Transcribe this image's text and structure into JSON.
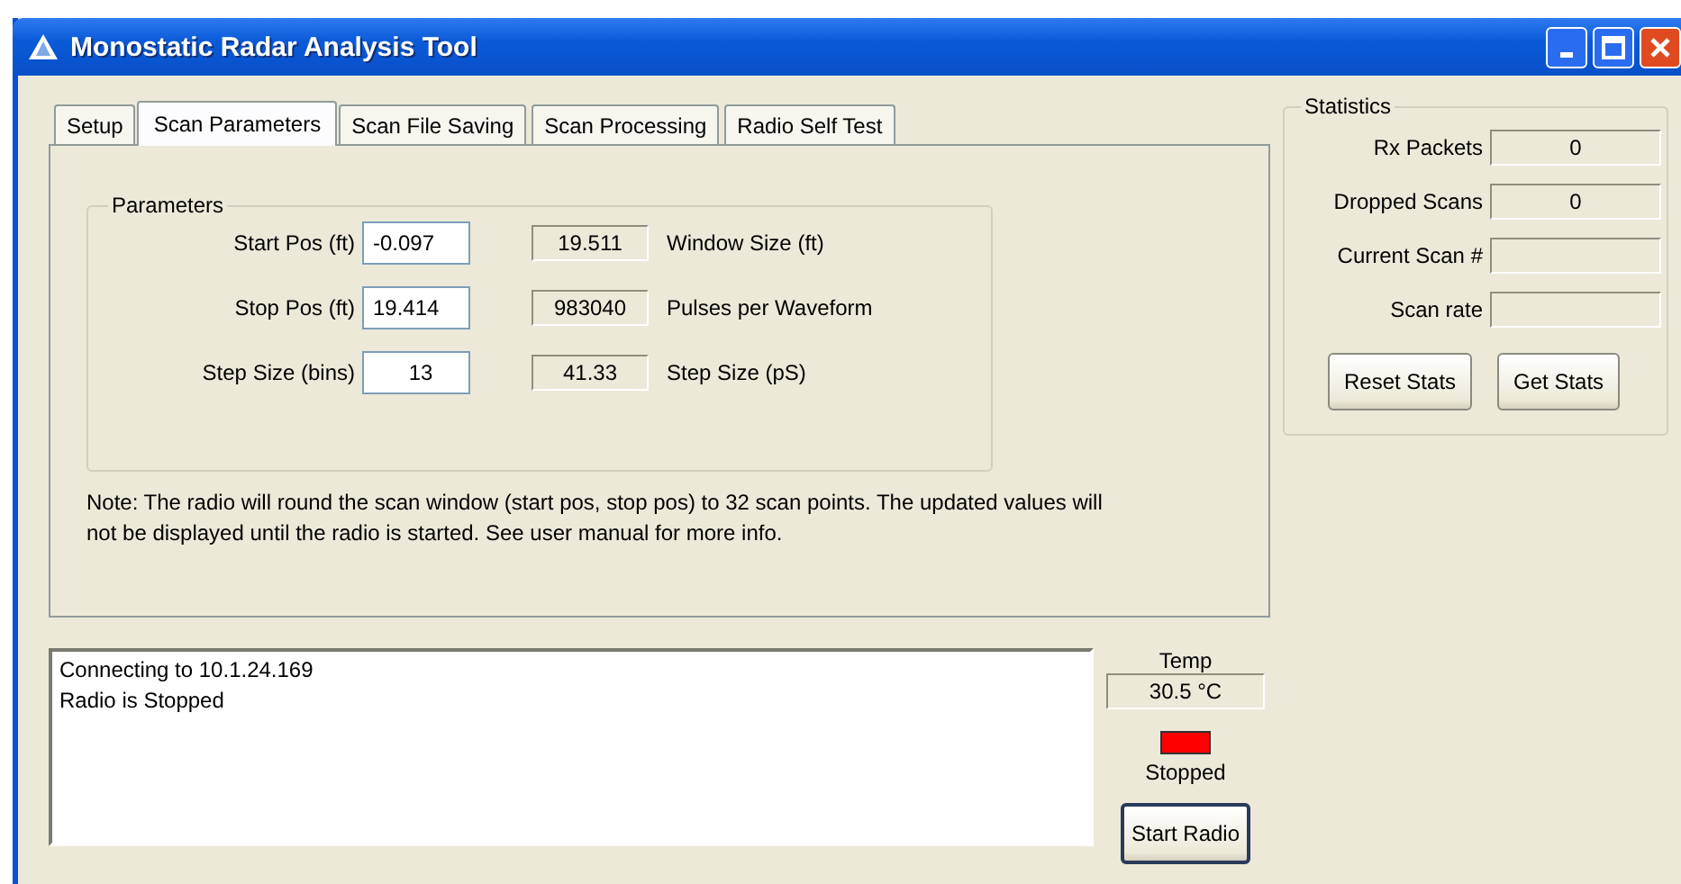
{
  "window": {
    "title": "Monostatic Radar Analysis Tool"
  },
  "tabs": [
    {
      "label": "Setup",
      "selected": false
    },
    {
      "label": "Scan Parameters",
      "selected": true
    },
    {
      "label": "Scan File Saving",
      "selected": false
    },
    {
      "label": "Scan Processing",
      "selected": false
    },
    {
      "label": "Radio Self Test",
      "selected": false
    }
  ],
  "parameters": {
    "title": "Parameters",
    "rows": [
      {
        "label": "Start Pos (ft)",
        "value": "-0.097",
        "readout": "19.511",
        "readout_label": "Window Size (ft)"
      },
      {
        "label": "Stop Pos (ft)",
        "value": "19.414",
        "readout": "983040",
        "readout_label": "Pulses per Waveform"
      },
      {
        "label": "Step Size (bins)",
        "value": "13",
        "readout": "41.33",
        "readout_label": "Step Size (pS)"
      }
    ]
  },
  "note": "Note: The radio will round the scan window (start pos, stop pos) to 32 scan points. The updated values will not be displayed until the radio is started. See user manual for more info.",
  "statistics": {
    "title": "Statistics",
    "rows": [
      {
        "label": "Rx Packets",
        "value": "0"
      },
      {
        "label": "Dropped Scans",
        "value": "0"
      },
      {
        "label": "Current Scan #"
      },
      {
        "label": "Scan rate"
      }
    ],
    "buttons": [
      "Reset Stats",
      "Get Stats"
    ]
  },
  "log": [
    "Connecting to 10.1.24.169",
    "Radio is Stopped"
  ],
  "temp": {
    "label": "Temp",
    "value": "30.5 °C"
  },
  "radio": {
    "default": true,
    "running": false,
    "status": "Stopped",
    "button": "Start Radio"
  }
}
